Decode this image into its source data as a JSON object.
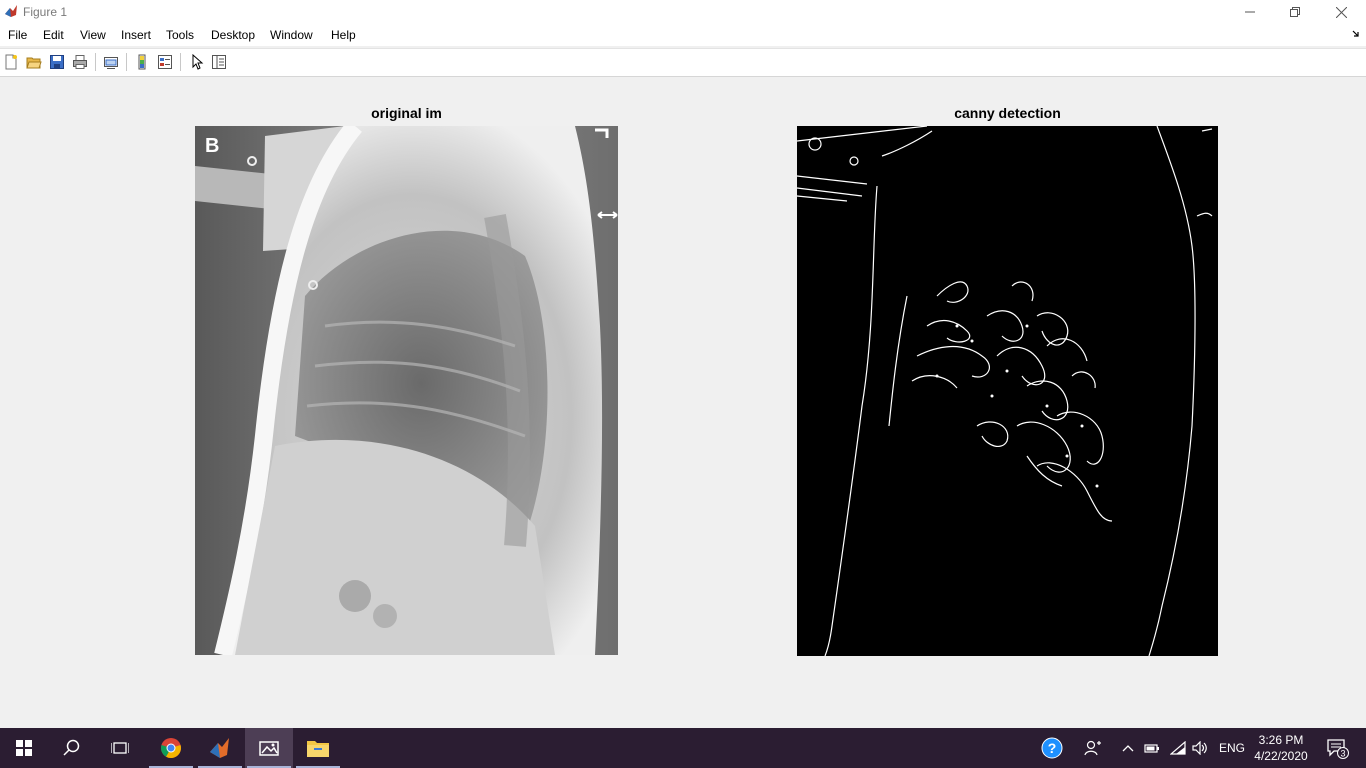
{
  "window": {
    "title": "Figure 1"
  },
  "menu": [
    "File",
    "Edit",
    "View",
    "Insert",
    "Tools",
    "Desktop",
    "Window",
    "Help"
  ],
  "toolbar": {
    "buttons": [
      "new-figure-icon",
      "open-file-icon",
      "save-icon",
      "print-icon",
      "link-plot-icon",
      "insert-colorbar-icon",
      "insert-legend-icon",
      "edit-plot-pointer-icon",
      "property-inspector-icon"
    ]
  },
  "axes": [
    {
      "title": "original im",
      "overlay_letter": "B"
    },
    {
      "title": "canny detection"
    }
  ],
  "taskbar": {
    "apps": [
      "start-icon",
      "search-icon",
      "task-view-icon",
      "chrome-icon",
      "matlab-icon",
      "photos-icon",
      "file-explorer-icon"
    ],
    "language": "ENG",
    "time": "3:26 PM",
    "date": "4/22/2020",
    "notification_count": "3"
  },
  "colors": {
    "taskbar": "#2b1d32",
    "figure_bg": "#f0f0f0",
    "help_icon": "#1e90ff"
  }
}
